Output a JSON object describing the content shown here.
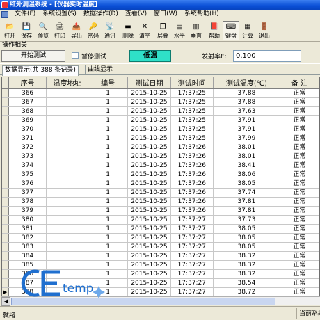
{
  "title": "红外测温系统 - [仪器实时温度]",
  "menu": [
    "文件(F)",
    "系统设置(S)",
    "数据操作(D)",
    "查看(V)",
    "窗口(W)",
    "系统帮助(H)"
  ],
  "toolbar": [
    {
      "label": "打开",
      "icon": "open-folder-icon",
      "glyph": "📂"
    },
    {
      "label": "保存",
      "icon": "save-icon",
      "glyph": "💾"
    },
    {
      "label": "预览",
      "icon": "preview-icon",
      "glyph": "🔍"
    },
    {
      "label": "打印",
      "icon": "print-icon",
      "glyph": "🖨"
    },
    {
      "label": "导出",
      "icon": "export-icon",
      "glyph": "📤"
    },
    {
      "label": "密码",
      "icon": "password-icon",
      "glyph": "🔑"
    },
    {
      "label": "通讯",
      "icon": "communication-icon",
      "glyph": "📡"
    },
    {
      "label": "删除",
      "icon": "delete-icon",
      "glyph": "▬"
    },
    {
      "label": "清空",
      "icon": "clear-icon",
      "glyph": "✕"
    },
    {
      "label": "层叠",
      "icon": "cascade-icon",
      "glyph": "❐"
    },
    {
      "label": "水平",
      "icon": "tile-horizontal-icon",
      "glyph": "▤"
    },
    {
      "label": "垂直",
      "icon": "tile-vertical-icon",
      "glyph": "▥"
    },
    {
      "label": "帮助",
      "icon": "help-icon",
      "glyph": "📕"
    },
    {
      "label": "键盘",
      "icon": "keyboard-icon",
      "glyph": "⌨"
    },
    {
      "label": "计算",
      "icon": "calculator-icon",
      "glyph": "▦"
    },
    {
      "label": "退出",
      "icon": "exit-icon",
      "glyph": "🚪"
    }
  ],
  "ops": {
    "section_label": "操作相关",
    "start_button": "开始测试",
    "pause_label": "暂停测试",
    "status_badge": "低温",
    "emissivity_label": "发射率E:",
    "emissivity_value": "0.100"
  },
  "tabs": {
    "data_tab": "数据显示(共 388 条记录)",
    "curve_tab": "曲线显示"
  },
  "table": {
    "columns": [
      "序号",
      "温度地址",
      "编号",
      "测试日期",
      "测试时间",
      "测试温度(℃)",
      "备 注"
    ],
    "rows": [
      [
        "366",
        "",
        "1",
        "2015-10-25",
        "17:37:25",
        "37.88",
        "正常"
      ],
      [
        "367",
        "",
        "1",
        "2015-10-25",
        "17:37:25",
        "37.88",
        "正常"
      ],
      [
        "368",
        "",
        "1",
        "2015-10-25",
        "17:37:25",
        "37.63",
        "正常"
      ],
      [
        "369",
        "",
        "1",
        "2015-10-25",
        "17:37:25",
        "37.91",
        "正常"
      ],
      [
        "370",
        "",
        "1",
        "2015-10-25",
        "17:37:25",
        "37.91",
        "正常"
      ],
      [
        "371",
        "",
        "1",
        "2015-10-25",
        "17:37:25",
        "37.99",
        "正常"
      ],
      [
        "372",
        "",
        "1",
        "2015-10-25",
        "17:37:26",
        "38.01",
        "正常"
      ],
      [
        "373",
        "",
        "1",
        "2015-10-25",
        "17:37:26",
        "38.01",
        "正常"
      ],
      [
        "374",
        "",
        "1",
        "2015-10-25",
        "17:37:26",
        "38.41",
        "正常"
      ],
      [
        "375",
        "",
        "1",
        "2015-10-25",
        "17:37:26",
        "38.06",
        "正常"
      ],
      [
        "376",
        "",
        "1",
        "2015-10-25",
        "17:37:26",
        "38.05",
        "正常"
      ],
      [
        "377",
        "",
        "1",
        "2015-10-25",
        "17:37:26",
        "37.74",
        "正常"
      ],
      [
        "378",
        "",
        "1",
        "2015-10-25",
        "17:37:26",
        "37.81",
        "正常"
      ],
      [
        "379",
        "",
        "1",
        "2015-10-25",
        "17:37:26",
        "37.81",
        "正常"
      ],
      [
        "380",
        "",
        "1",
        "2015-10-25",
        "17:37:27",
        "37.73",
        "正常"
      ],
      [
        "381",
        "",
        "1",
        "2015-10-25",
        "17:37:27",
        "38.05",
        "正常"
      ],
      [
        "382",
        "",
        "1",
        "2015-10-25",
        "17:37:27",
        "38.05",
        "正常"
      ],
      [
        "383",
        "",
        "1",
        "2015-10-25",
        "17:37:27",
        "38.05",
        "正常"
      ],
      [
        "384",
        "",
        "1",
        "2015-10-25",
        "17:37:27",
        "38.32",
        "正常"
      ],
      [
        "385",
        "",
        "1",
        "2015-10-25",
        "17:37:27",
        "38.32",
        "正常"
      ],
      [
        "386",
        "",
        "1",
        "2015-10-25",
        "17:37:27",
        "38.32",
        "正常"
      ],
      [
        "387",
        "",
        "1",
        "2015-10-25",
        "17:37:27",
        "38.54",
        "正常"
      ],
      [
        "388",
        "",
        "1",
        "2015-10-25",
        "17:37:27",
        "38.72",
        "正常"
      ]
    ]
  },
  "status": {
    "left": "就绪",
    "right": "当前系统"
  },
  "logo_text": "CEtemp",
  "colors": {
    "title_bar": "#0a4fd6",
    "status_badge": "#2fe0c8",
    "grid_background": "#ababab",
    "logo_blue": "#1f6fcf"
  }
}
